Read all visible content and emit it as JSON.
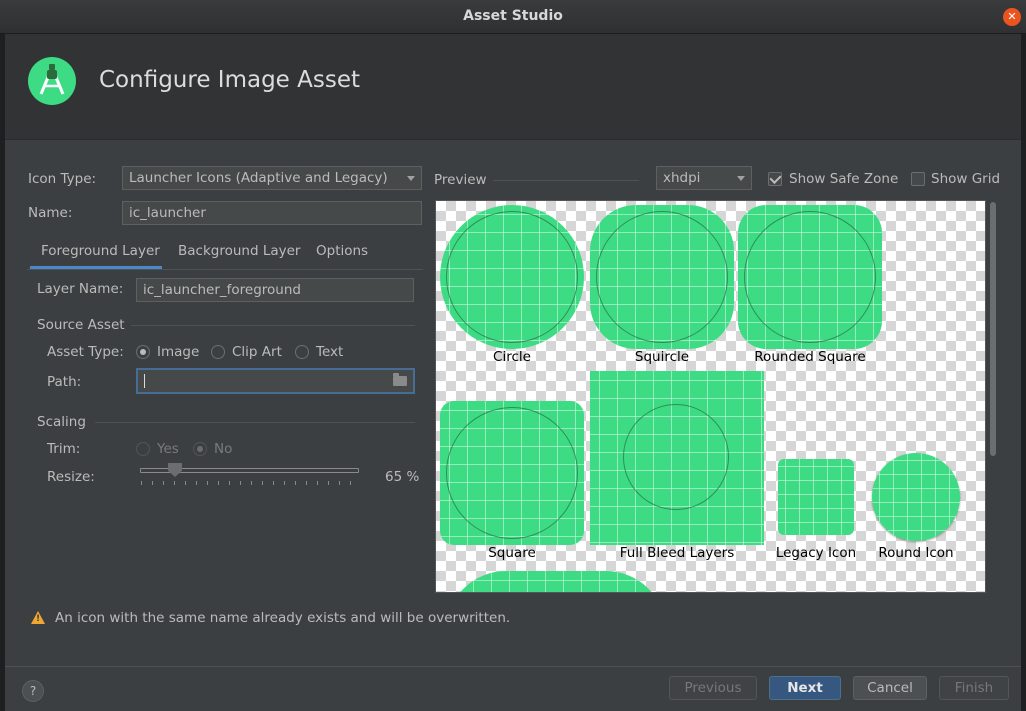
{
  "window": {
    "title": "Asset Studio"
  },
  "header": {
    "heading": "Configure Image Asset"
  },
  "form": {
    "icon_type_label": "Icon Type:",
    "icon_type_value": "Launcher Icons (Adaptive and Legacy)",
    "name_label": "Name:",
    "name_value": "ic_launcher"
  },
  "tabs": [
    {
      "label": "Foreground Layer",
      "active": true
    },
    {
      "label": "Background Layer",
      "active": false
    },
    {
      "label": "Options",
      "active": false
    }
  ],
  "layer": {
    "layer_name_label": "Layer Name:",
    "layer_name_value": "ic_launcher_foreground",
    "source_asset_label": "Source Asset",
    "asset_type_label": "Asset Type:",
    "asset_types": [
      "Image",
      "Clip Art",
      "Text"
    ],
    "asset_type_selected": "Image",
    "path_label": "Path:",
    "path_value": ""
  },
  "scaling": {
    "section_label": "Scaling",
    "trim_label": "Trim:",
    "trim_yes": "Yes",
    "trim_no": "No",
    "trim_selected": "No",
    "resize_label": "Resize:",
    "resize_value": "65 %",
    "resize_percent": 65
  },
  "preview": {
    "label": "Preview",
    "density_value": "xhdpi",
    "show_safe_zone_label": "Show Safe Zone",
    "show_safe_zone_checked": true,
    "show_grid_label": "Show Grid",
    "show_grid_checked": false,
    "captions": {
      "circle": "Circle",
      "squircle": "Squircle",
      "rounded_square": "Rounded Square",
      "square": "Square",
      "full_bleed": "Full Bleed Layers",
      "legacy": "Legacy Icon",
      "round": "Round Icon"
    }
  },
  "warning": {
    "text": "An icon with the same name already exists and will be overwritten."
  },
  "footer": {
    "help": "?",
    "previous": "Previous",
    "next": "Next",
    "cancel": "Cancel",
    "finish": "Finish"
  },
  "colors": {
    "accent": "#4a88c7",
    "icon_green": "#3ddc84",
    "primary_button": "#365880",
    "warning": "#f0a732"
  }
}
